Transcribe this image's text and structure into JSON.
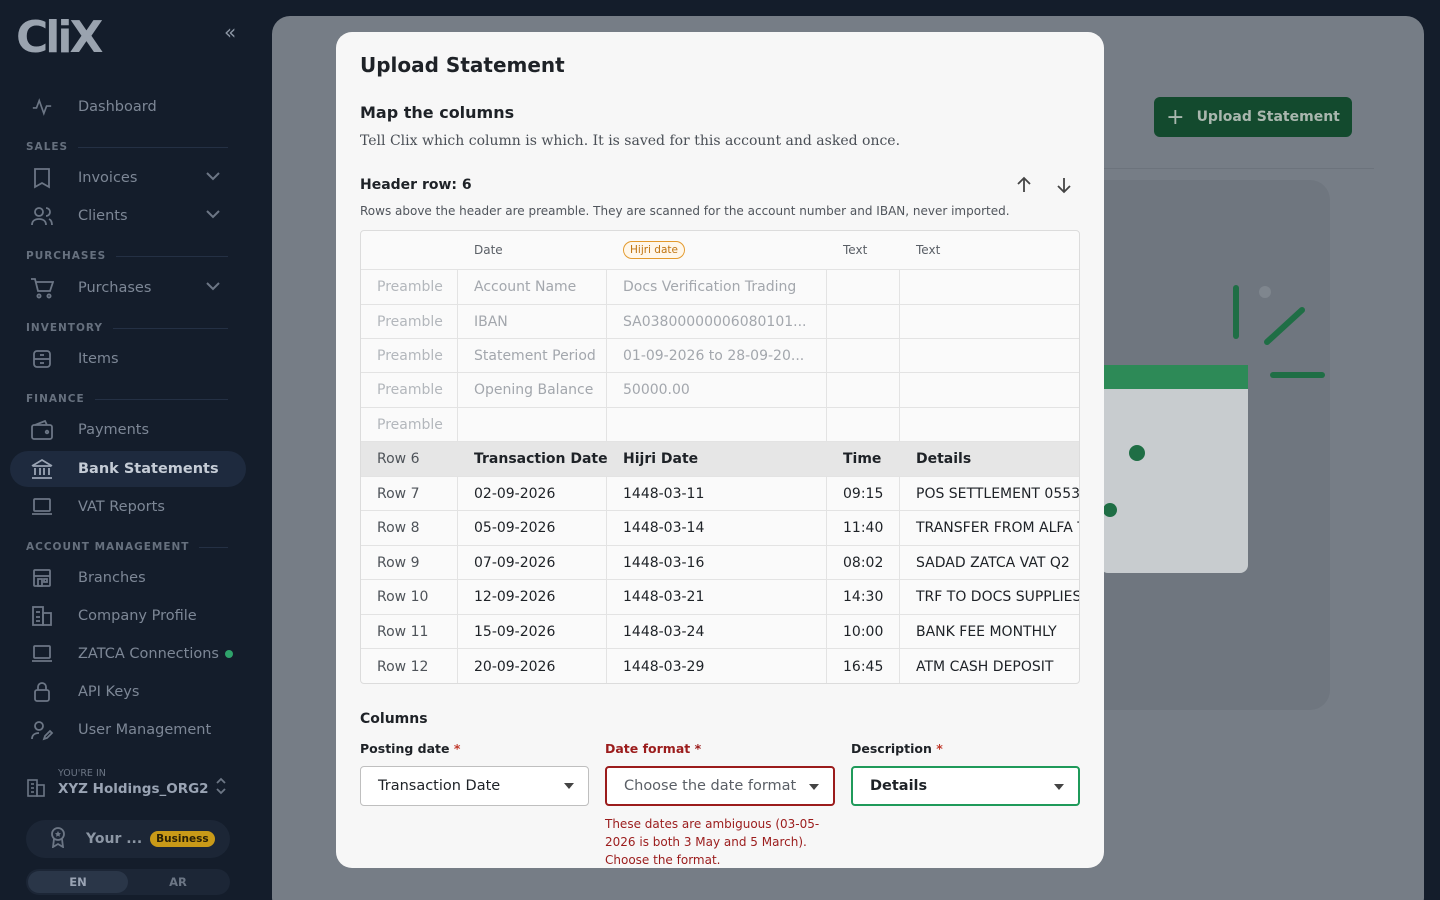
{
  "app": {
    "logo": "CliX",
    "collapse_icon": "«"
  },
  "sidebar": {
    "dashboard": "Dashboard",
    "sections": {
      "sales": "SALES",
      "purchases": "PURCHASES",
      "inventory": "INVENTORY",
      "finance": "FINANCE",
      "account_management": "ACCOUNT MANAGEMENT"
    },
    "items": {
      "invoices": "Invoices",
      "clients": "Clients",
      "purchases": "Purchases",
      "items": "Items",
      "payments": "Payments",
      "bank_statements": "Bank Statements",
      "vat_reports": "VAT Reports",
      "branches": "Branches",
      "company_profile": "Company Profile",
      "zatca_connections": "ZATCA Connections",
      "api_keys": "API Keys",
      "user_management": "User Management"
    },
    "org": {
      "label": "YOU'RE IN",
      "name": "XYZ Holdings_ORG2"
    },
    "plan": {
      "label": "Your ...",
      "badge": "Business"
    },
    "languages": [
      "EN",
      "AR"
    ],
    "active_language": "EN",
    "colors": {
      "active_bg": "#1e2a3e",
      "status_dot": "#2fa36b",
      "plan_badge": "#c99a18"
    }
  },
  "main": {
    "upload_button": "Upload Statement",
    "primary_color": "#134a2e"
  },
  "modal": {
    "title": "Upload Statement",
    "subtitle": "Map the columns",
    "description": "Tell Clix which column is which. It is saved for this account and asked once.",
    "header_row_label": "Header row: 6",
    "header_note": "Rows above the header are preamble. They are scanned for the account number and IBAN, never imported.",
    "table": {
      "type_headers": [
        "",
        "Date",
        "Hijri date",
        "Text",
        "Text"
      ],
      "preamble_rows": [
        [
          "Preamble",
          "Account Name",
          "Docs Verification Trading",
          "",
          ""
        ],
        [
          "Preamble",
          "IBAN",
          "SA03800000006080101...",
          "",
          ""
        ],
        [
          "Preamble",
          "Statement Period",
          "01-09-2026 to 28-09-20...",
          "",
          ""
        ],
        [
          "Preamble",
          "Opening Balance",
          "50000.00",
          "",
          ""
        ],
        [
          "Preamble",
          "",
          "",
          "",
          ""
        ]
      ],
      "header_row": [
        "Row 6",
        "Transaction Date",
        "Hijri Date",
        "Time",
        "Details"
      ],
      "data_rows": [
        [
          "Row 7",
          "02-09-2026",
          "1448-03-11",
          "09:15",
          "POS SETTLEMENT 0553"
        ],
        [
          "Row 8",
          "05-09-2026",
          "1448-03-14",
          "11:40",
          "TRANSFER FROM ALFA T"
        ],
        [
          "Row 9",
          "07-09-2026",
          "1448-03-16",
          "08:02",
          "SADAD ZATCA VAT Q2"
        ],
        [
          "Row 10",
          "12-09-2026",
          "1448-03-21",
          "14:30",
          "TRF TO DOCS SUPPLIES"
        ],
        [
          "Row 11",
          "15-09-2026",
          "1448-03-24",
          "10:00",
          "BANK FEE MONTHLY"
        ],
        [
          "Row 12",
          "20-09-2026",
          "1448-03-29",
          "16:45",
          "ATM CASH DEPOSIT"
        ]
      ]
    },
    "columns_title": "Columns",
    "fields": {
      "posting_date": {
        "label": "Posting date",
        "required": "*",
        "value": "Transaction Date"
      },
      "date_format": {
        "label": "Date format",
        "required": "*",
        "placeholder": "Choose the date format",
        "error": "These dates are ambiguous (03-05-2026 is both 3 May and 5 March). Choose the format."
      },
      "description": {
        "label": "Description",
        "required": "*",
        "value": "Details"
      }
    },
    "colors": {
      "error": "#9b1c1c",
      "valid": "#1f9a5a",
      "hijri_badge": "#e39a2d"
    }
  }
}
